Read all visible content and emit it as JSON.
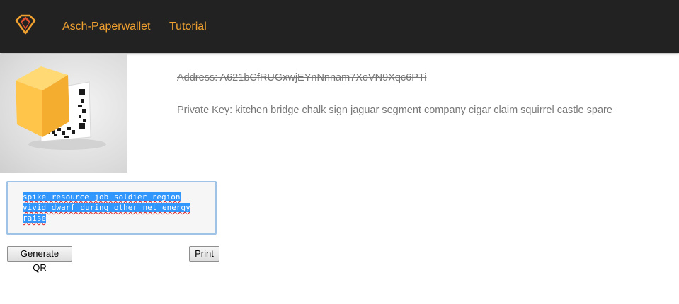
{
  "nav": {
    "brand": "Asch-Paperwallet",
    "tutorial": "Tutorial",
    "logo_color": "#f0a130"
  },
  "wallet": {
    "address": "Address: A621bCfRUGxwjEYnNnnam7XoVN9Xqc6PTi",
    "private_key": "Private Key: kitchen bridge chalk sign jaguar segment company cigar claim squirrel castle spare"
  },
  "phrase_input": {
    "value": "spike resource job soldier region vivid dwarf during other net energy raise",
    "selection_color": "#3297fd"
  },
  "buttons": {
    "generate": "Generate QR",
    "print": "Print"
  }
}
